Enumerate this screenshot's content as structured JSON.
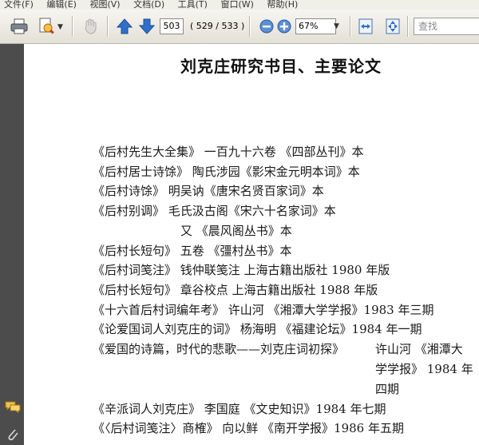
{
  "menu": {
    "items": [
      "文件(F)",
      "编辑(E)",
      "视图(V)",
      "文档(D)",
      "工具(T)",
      "窗口(W)",
      "帮助(H)"
    ]
  },
  "toolbar": {
    "page_number": "503",
    "page_count": "( 529 / 533 )",
    "zoom": "67%",
    "search_placeholder": "查找"
  },
  "icons": [
    "print-icon",
    "document-search-icon",
    "hand-tool-icon",
    "page-up-icon",
    "page-down-icon",
    "zoom-out-icon",
    "zoom-in-icon",
    "fit-width-icon",
    "full-screen-icon",
    "comments-icon",
    "attachment-icon"
  ],
  "colors": {
    "accent_blue": "#2f6fc9",
    "sidepane": "#4c4c4c"
  },
  "document": {
    "title": "刘克庄研究书目、主要论文",
    "lines": [
      "《后村先生大全集》  一百九十六卷    《四部丛刊》本",
      "《后村居士诗馀》    陶氏涉园《影宋金元明本词》本",
      "《后村诗馀》    明吴讷《唐宋名贤百家词》本",
      "《后村别调》    毛氏汲古阁《宋六十名家词》本",
      "又  《晨风阁丛书》本",
      "《后村长短句》  五卷  《彊村丛书》本",
      "《后村词笺注》    钱仲联笺注    上海古籍出版社 1980 年版",
      "《后村长短句》    章谷校点    上海古籍出版社 1988 年版",
      "《十六首后村词编年考》    许山河  《湘潭大学学报》1983 年三期",
      "《论爱国词人刘克庄的词》    杨海明  《福建论坛》1984 年一期",
      "《爱国的诗篇，时代的悲歌——刘克庄词初探》",
      "许山河  《湘潭大",
      "学学报》 1984  年",
      "四期",
      "《辛派词人刘克庄》    李国庭  《文史知识》1984 年七期",
      "《〈后村词笺注〉商榷》    向以鲜  《南开学报》1986 年五期"
    ]
  }
}
